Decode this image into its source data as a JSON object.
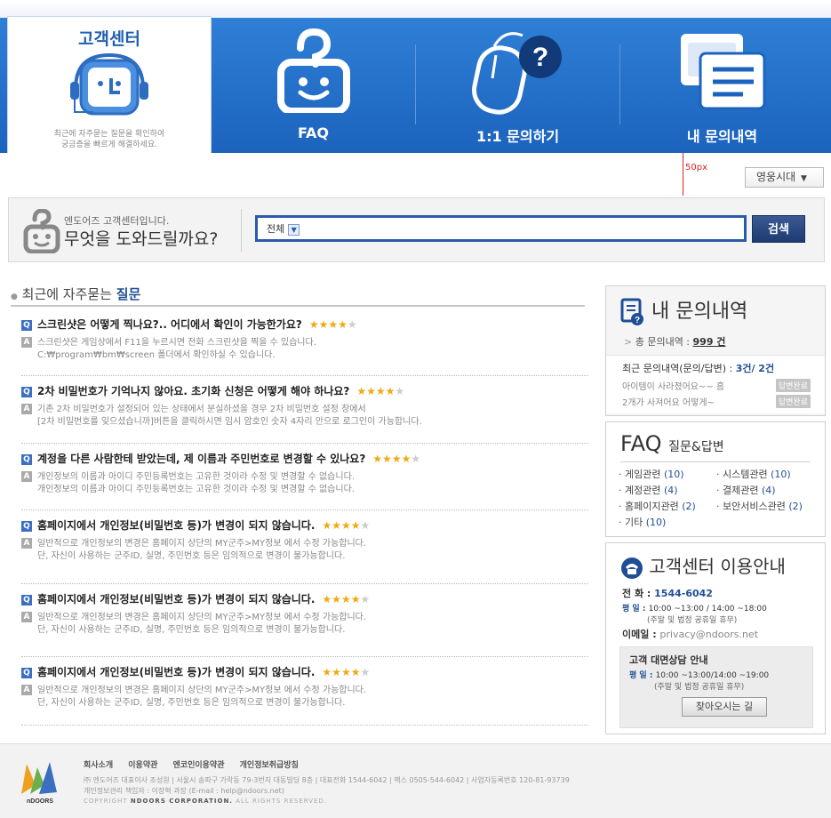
{
  "nav": {
    "home_title": "고객센터",
    "home_desc1": "최근에 자주묻는 질문을 확인하여",
    "home_desc2": "궁금증을 빠르게 해결하세요.",
    "tabs": [
      {
        "label": "FAQ",
        "icon": "face-question-icon"
      },
      {
        "label": "1:1 문의하기",
        "icon": "mouse-question-icon"
      },
      {
        "label": "내 문의내역",
        "icon": "documents-icon"
      }
    ]
  },
  "ruler_label": "50px",
  "lang_select": "영웅시대",
  "search": {
    "welcome": "엔도어즈 고객센터입니다.",
    "question": "무엇을 도와드릴까요?",
    "category": "전체",
    "button": "검색"
  },
  "faq": {
    "heading_prefix": "최근에 자주묻는 ",
    "heading_bold": "질문",
    "items": [
      {
        "q": "스크린샷은 어떻게 찍나요?.. 어디에서 확인이 가능한가요?",
        "rating": 4,
        "a1": "스크린샷은 게임상에서 F11을 누르시면 전화 스크린샷을 찍을 수 있습니다.",
        "a2": "C:₩program₩bm₩screen 폴더에서 확인하실 수 있습니다."
      },
      {
        "q": "2차 비밀번호가 기억나지 않아요. 초기화 신청은 어떻게 해야 하나요?",
        "rating": 4,
        "a1": "기존 2차 비밀번호가 설정되어 있는 상태에서 분실하셨을 경우 2차 비밀번호 설정 창에서",
        "a2": "[2차 비밀번호를 잊으셨습니까]버튼을 클릭하시면 임시 암호인 숫자 4자리 만으로 로그인이 가능합니다."
      },
      {
        "q": "계정을 다른 사람한테 받았는데, 제 이름과 주민번호로 변경할 수 있나요?",
        "rating": 4,
        "a1": "개인정보의 이름과 아이디 주민등록번호는 고유한 것이라 수정 및 변경할 수 없습니다.",
        "a2": "개인정보의 이름과 아이디 주민등록번호는 고유한 것이라 수정 및 변경할 수 없습니다."
      },
      {
        "q": "홈페이지에서 개인정보(비밀번호 등)가 변경이 되지 않습니다.",
        "rating": 4,
        "a1": "일반적으로 개인정보의 변경은 홈페이지 상단의 MY군주>MY정보 에서 수정 가능합니다.",
        "a2": "단, 자신이 사용하는 군주ID, 실명, 주민번호 등은 임의적으로 변경이 불가능합니다."
      },
      {
        "q": "홈페이지에서 개인정보(비밀번호 등)가 변경이 되지 않습니다.",
        "rating": 4,
        "a1": "일반적으로 개인정보의 변경은 홈페이지 상단의 MY군주>MY정보 에서 수정 가능합니다.",
        "a2": "단, 자신이 사용하는 군주ID, 실명, 주민번호 등은 임의적으로 변경이 불가능합니다."
      },
      {
        "q": "홈페이지에서 개인정보(비밀번호 등)가 변경이 되지 않습니다.",
        "rating": 4,
        "a1": "일반적으로 개인정보의 변경은 홈페이지 상단의 MY군주>MY정보 에서 수정 가능합니다.",
        "a2": "단, 자신이 사용하는 군주ID, 실명, 주민번호 등은 임의적으로 변경이 불가능합니다."
      }
    ]
  },
  "myq": {
    "title": "내 문의내역",
    "total_label": "총 문의내역 : ",
    "total_value": "999 건",
    "recent_label": "최근 문의내역(문의/답변) : ",
    "recent_value": "3건/ 2건",
    "rows": [
      {
        "text": "아이템이 사라졌어요~~ 흠",
        "badge": "답변완료"
      },
      {
        "text": "2개가 사져어요 어떻게~",
        "badge": "답변완료"
      }
    ]
  },
  "faq_box": {
    "title": "FAQ",
    "subtitle": "질문&답변",
    "cats": [
      {
        "label": "게임관련",
        "count": "(10)"
      },
      {
        "label": "시스템관련",
        "count": "(10)"
      },
      {
        "label": "계정관련",
        "count": "(4)"
      },
      {
        "label": "결제관련",
        "count": "(4)"
      },
      {
        "label": "홈페이지관련",
        "count": "(2)"
      },
      {
        "label": "보안서비스관련",
        "count": "(2)"
      },
      {
        "label": "기타",
        "count": "(10)"
      }
    ]
  },
  "info": {
    "title": "고객센터 이용안내",
    "phone_label": "전 화 : ",
    "phone": "1544-6042",
    "weekday_label": "평 일 : ",
    "weekday_hours": "10:00 ~13:00 / 14:00 ~18:00",
    "weekday_note": "(주말 및 법정 공휴일 휴무)",
    "email_label": "이메일 : ",
    "email": "privacy@ndoors.net",
    "visit_title": "고객 대면상담 안내",
    "visit_hours_label": "평 일 : ",
    "visit_hours": "10:00 ~13:00/14:00 ~19:00",
    "visit_note": "(주말 및 법정 공휴일 휴무)",
    "visit_button": "찾아오시는 길"
  },
  "footer": {
    "links": [
      "회사소개",
      "이용약관",
      "엔코인이용약관",
      "개인정보취급방침"
    ],
    "address1": "㈜ 엔도어즈 대표이사 조성원 | 서울시 송파구 가락동 79-3번지 대동빌딩 8층 | 대표전화 1544-6042 | 팩스 0505-544-6042 | 사업자등록번호 120-81-93739",
    "address2": "개인정보관리 책임자 : 이장혁 과장 (E-mail : help@ndoors.net)",
    "copy_prefix": "COPYRIGHT ",
    "copy_brand": "NDOORS CORPORATION.",
    "copy_suffix": " ALL RIGHTS RESERVED.",
    "logo_text": "nDOORS"
  }
}
